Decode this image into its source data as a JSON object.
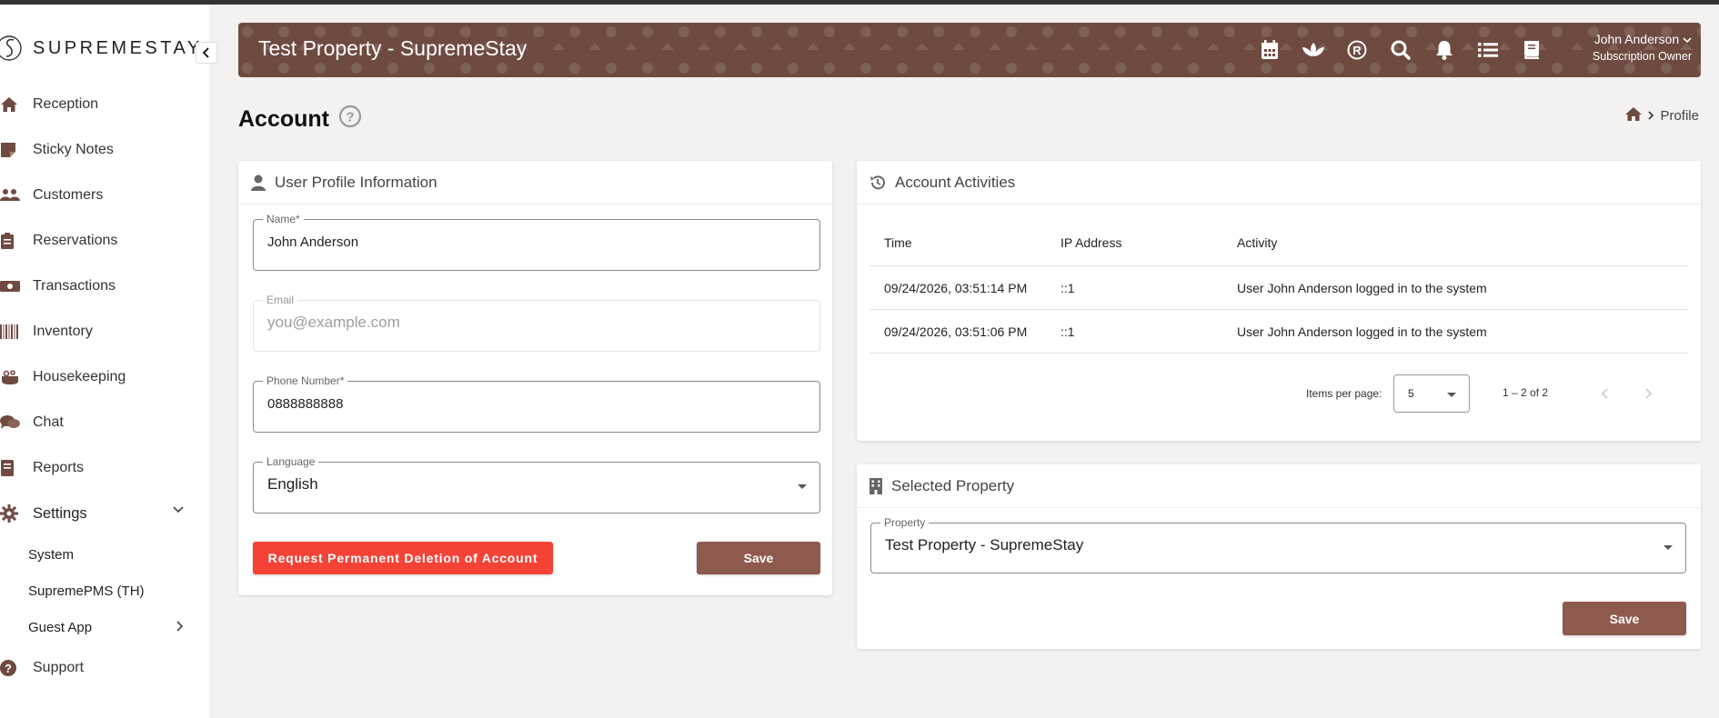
{
  "brand": {
    "name": "SUPREMESTAY"
  },
  "sidebar": {
    "items": [
      {
        "label": "Reception",
        "icon": "home-icon"
      },
      {
        "label": "Sticky Notes",
        "icon": "sticky-note-icon"
      },
      {
        "label": "Customers",
        "icon": "users-icon"
      },
      {
        "label": "Reservations",
        "icon": "clipboard-icon"
      },
      {
        "label": "Transactions",
        "icon": "money-icon"
      },
      {
        "label": "Inventory",
        "icon": "barcode-icon"
      },
      {
        "label": "Housekeeping",
        "icon": "housekeeping-icon"
      },
      {
        "label": "Chat",
        "icon": "chat-icon"
      },
      {
        "label": "Reports",
        "icon": "book-icon"
      },
      {
        "label": "Settings",
        "icon": "gear-icon"
      }
    ],
    "settings_sub": [
      {
        "label": "System"
      },
      {
        "label": "SupremePMS (TH)"
      },
      {
        "label": "Guest App"
      }
    ],
    "support": {
      "label": "Support",
      "icon": "question-circle-icon"
    }
  },
  "header": {
    "title": "Test Property - SupremeStay",
    "user_name": "John Anderson",
    "user_role": "Subscription Owner",
    "bg_color": "#6e4a40"
  },
  "page": {
    "title": "Account",
    "breadcrumb_current": "Profile"
  },
  "profile": {
    "title": "User Profile Information",
    "name_label": "Name*",
    "name_value": "John Anderson",
    "email_label": "Email",
    "email_placeholder": "you@example.com",
    "phone_label": "Phone Number*",
    "phone_value": "0888888888",
    "language_label": "Language",
    "language_value": "English",
    "delete_label": "Request Permanent Deletion of Account",
    "save_label": "Save"
  },
  "activities": {
    "title": "Account Activities",
    "columns": [
      "Time",
      "IP Address",
      "Activity"
    ],
    "rows": [
      [
        "09/24/2026, 03:51:14 PM",
        "::1",
        "User John Anderson logged in to the system"
      ],
      [
        "09/24/2026, 03:51:06 PM",
        "::1",
        "User John Anderson logged in to the system"
      ]
    ],
    "items_per_page_label": "Items per page:",
    "items_per_page": "5",
    "range": "1 – 2 of 2"
  },
  "property": {
    "title": "Selected Property",
    "label": "Property",
    "value": "Test Property - SupremeStay",
    "save_label": "Save"
  },
  "colors": {
    "accent": "#8e5a4d",
    "danger": "#f44336",
    "icon": "#6e4a40"
  }
}
